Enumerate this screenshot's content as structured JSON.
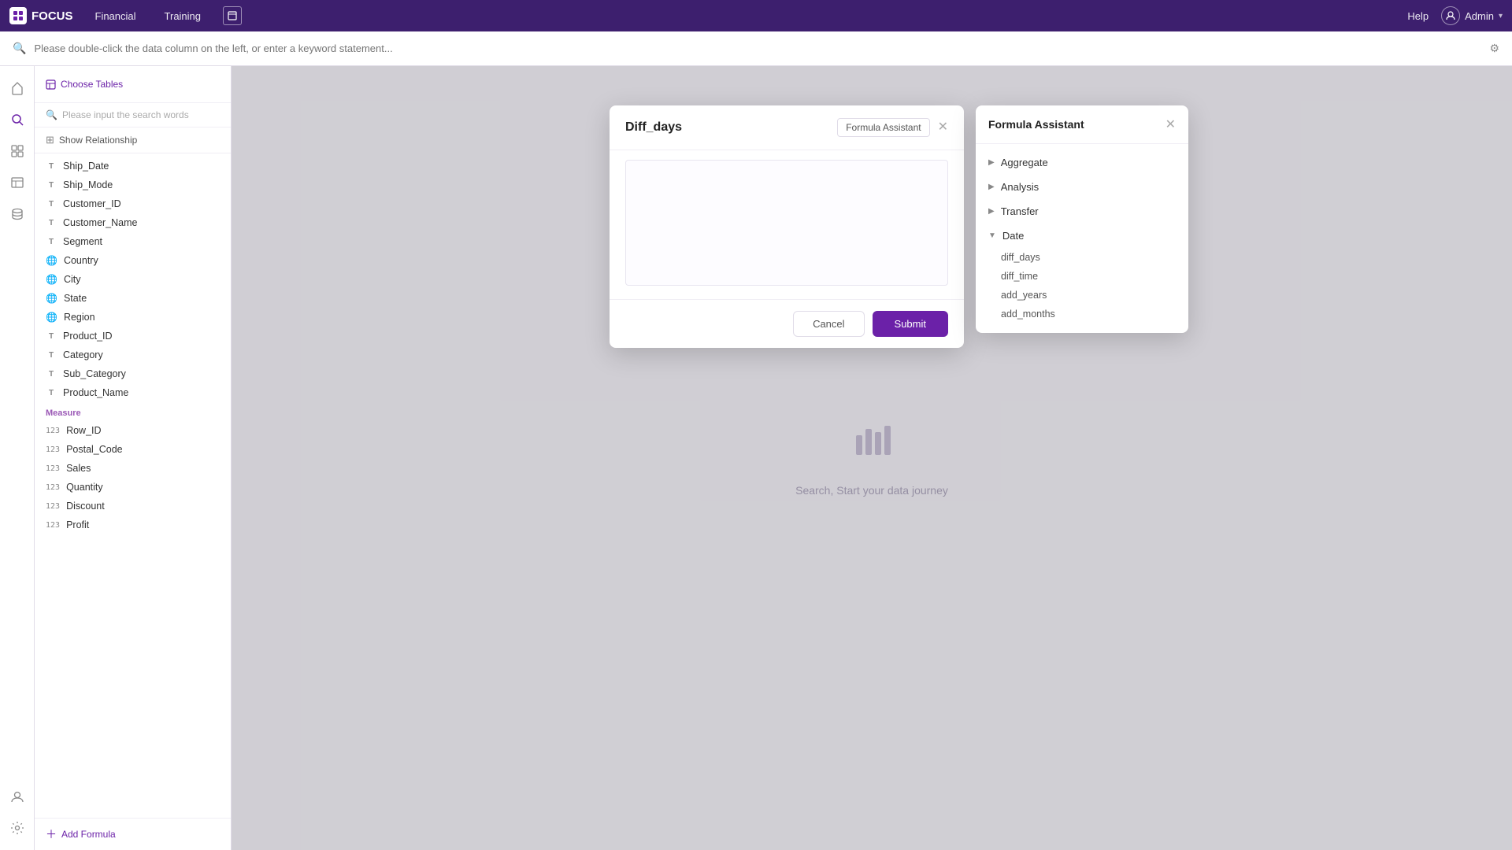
{
  "app": {
    "logo": "FOCUS",
    "nav_items": [
      "Financial",
      "Training"
    ],
    "help_label": "Help",
    "user_label": "Admin"
  },
  "search_bar": {
    "placeholder": "Please double-click the data column on the left, or enter a keyword statement..."
  },
  "sidebar": {
    "choose_tables_label": "Choose Tables",
    "search_placeholder": "Please input the search words",
    "show_relationship_label": "Show Relationship",
    "items_dimension": [
      {
        "type": "text",
        "label": "Ship_Date"
      },
      {
        "type": "text",
        "label": "Ship_Mode"
      },
      {
        "type": "text",
        "label": "Customer_ID"
      },
      {
        "type": "text",
        "label": "Customer_Name"
      },
      {
        "type": "text",
        "label": "Segment"
      },
      {
        "type": "globe",
        "label": "Country"
      },
      {
        "type": "globe",
        "label": "City"
      },
      {
        "type": "globe",
        "label": "State"
      },
      {
        "type": "globe",
        "label": "Region"
      },
      {
        "type": "text",
        "label": "Product_ID"
      },
      {
        "type": "text",
        "label": "Category"
      },
      {
        "type": "text",
        "label": "Sub_Category"
      },
      {
        "type": "text",
        "label": "Product_Name"
      }
    ],
    "measure_label": "Measure",
    "items_measure": [
      {
        "type": "number",
        "label": "Row_ID"
      },
      {
        "type": "number",
        "label": "Postal_Code"
      },
      {
        "type": "number",
        "label": "Sales"
      },
      {
        "type": "number",
        "label": "Quantity"
      },
      {
        "type": "number",
        "label": "Discount"
      },
      {
        "type": "number",
        "label": "Profit"
      }
    ],
    "add_formula_label": "Add Formula"
  },
  "content": {
    "placeholder_text": "Search, Start your data journey"
  },
  "dialog": {
    "title": "Diff_days",
    "formula_assistant_btn": "Formula Assistant",
    "cancel_label": "Cancel",
    "submit_label": "Submit",
    "textarea_placeholder": ""
  },
  "formula_assistant": {
    "title": "Formula Assistant",
    "categories": [
      {
        "name": "Aggregate",
        "expanded": false,
        "items": []
      },
      {
        "name": "Analysis",
        "expanded": false,
        "items": []
      },
      {
        "name": "Transfer",
        "expanded": false,
        "items": []
      },
      {
        "name": "Date",
        "expanded": true,
        "items": [
          "diff_days",
          "diff_time",
          "add_years",
          "add_months"
        ]
      }
    ]
  }
}
